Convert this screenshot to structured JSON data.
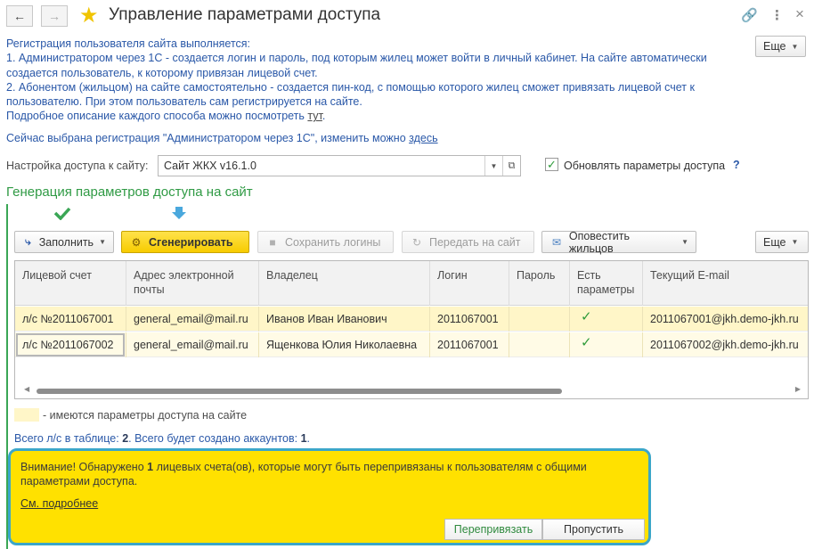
{
  "window": {
    "title": "Управление параметрами доступа",
    "back_icon": "arrow-left-icon",
    "forward_icon": "arrow-right-icon",
    "favorite_icon": "star-icon",
    "link_icon": "link-icon",
    "menu_icon": "kebab-icon",
    "close_icon": "close-icon"
  },
  "top_more_label": "Еще",
  "info": {
    "line1": "Регистрация пользователя сайта выполняется:",
    "line2": "1. Администратором через 1С - создается логин и пароль, под которым жилец может войти в личный кабинет. На сайте автоматически",
    "line3": "создается пользователь, к которому привязан лицевой счет.",
    "line4": "2. Абонентом (жильцом) на сайте самостоятельно - создается пин-код, с помощью которого жилец сможет привязать лицевой счет к",
    "line5": "пользователю. При этом пользователь сам регистрируется на сайте.",
    "line6_text": "Подробное описание каждого способа можно посмотреть ",
    "line6_link": "тут",
    "line6_end": ".",
    "current_text": "Сейчас выбрана регистрация \"Администратором через 1С\", изменить можно ",
    "current_link": "здесь"
  },
  "site_setting": {
    "label": "Настройка доступа к сайту:",
    "value": "Сайт ЖКХ v16.1.0",
    "update_label": "Обновлять параметры доступа",
    "update_checked": true,
    "help": "?"
  },
  "group": {
    "title": "Генерация параметров доступа на сайт"
  },
  "toolbar": {
    "fill": "Заполнить",
    "generate": "Сгенерировать",
    "save_logins": "Сохранить логины",
    "send_to_site": "Передать на сайт",
    "notify": "Оповестить жильцов",
    "more": "Еще"
  },
  "table": {
    "headers": {
      "account": "Лицевой счет",
      "email_line1": "Адрес электронной",
      "email_line2": "почты",
      "owner": "Владелец",
      "login": "Логин",
      "password": "Пароль",
      "has_params_line1": "Есть",
      "has_params_line2": "параметры",
      "current_email": "Текущий E-mail"
    },
    "rows": [
      {
        "account": "л/с №2011067001",
        "email": "general_email@mail.ru",
        "owner": "Иванов Иван Иванович",
        "login": "2011067001",
        "password": "",
        "has_params": "✓",
        "current_email": "2011067001@jkh.demo-jkh.ru"
      },
      {
        "account": "л/с №2011067002",
        "email": "general_email@mail.ru",
        "owner": "Ященкова Юлия Николаевна",
        "login": "2011067001",
        "password": "",
        "has_params": "✓",
        "current_email": "2011067002@jkh.demo-jkh.ru"
      }
    ]
  },
  "legend": {
    "text": "- имеются параметры доступа на сайте",
    "color": "#fff6c8"
  },
  "totals": {
    "prefix": "Всего л/с в таблице: ",
    "count": "2",
    "middle": ". Всего будет создано аккаунтов: ",
    "accounts": "1",
    "end": "."
  },
  "warning": {
    "prefix": "Внимание! Обнаружено ",
    "count": "1",
    "suffix": " лицевых счета(ов), которые могут быть перепривязаны к пользователям с общими параметрами доступа.",
    "details_link": "См. подробнее",
    "rebind": "Перепривязать",
    "skip": "Пропустить"
  },
  "colors": {
    "accent_green": "#2f9a44",
    "link_blue": "#2a58a8",
    "warning_bg": "#ffe100",
    "warning_border": "#3ba6c9",
    "primary_button": "#f7cc00"
  }
}
